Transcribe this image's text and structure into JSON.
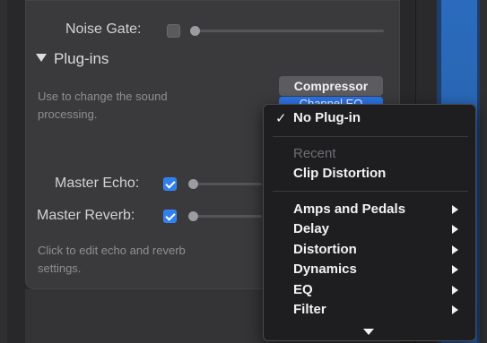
{
  "noise_gate": {
    "label": "Noise Gate:",
    "enabled": false
  },
  "plugins": {
    "heading": "Plug-ins",
    "help_line1": "Use to change the sound",
    "help_line2": "processing.",
    "slots": [
      {
        "label": "Compressor"
      },
      {
        "label": "Channel EQ"
      }
    ]
  },
  "master_echo": {
    "label": "Master Echo:",
    "enabled": true
  },
  "master_reverb": {
    "label": "Master Reverb:",
    "enabled": true
  },
  "echo_reverb_help": {
    "line1": "Click to edit echo and reverb",
    "line2": "settings."
  },
  "menu": {
    "selected": {
      "check": "✓",
      "label": "No Plug-in"
    },
    "recent_header": "Recent",
    "recent_items": [
      {
        "label": "Clip Distortion"
      }
    ],
    "categories": [
      {
        "label": "Amps and Pedals"
      },
      {
        "label": "Delay"
      },
      {
        "label": "Distortion"
      },
      {
        "label": "Dynamics"
      },
      {
        "label": "EQ"
      },
      {
        "label": "Filter"
      }
    ]
  },
  "colors": {
    "accent": "#2f7ff0",
    "menu_background": "#1e1e20",
    "panel_background": "#3a3a3c",
    "track_blue": "#2b6bbd"
  }
}
